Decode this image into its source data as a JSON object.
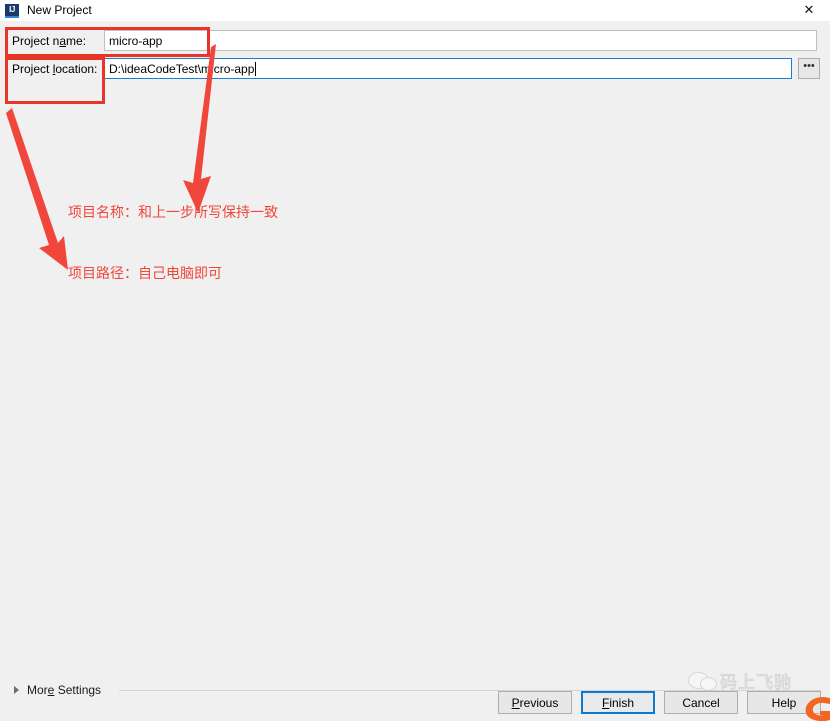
{
  "window": {
    "title": "New Project",
    "icon": "intellij-idea-icon",
    "icon_text": "IJ",
    "close_label": "✕"
  },
  "form": {
    "project_name": {
      "label_prefix": "Project n",
      "label_mnemonic": "a",
      "label_suffix": "me:",
      "value": "micro-app",
      "placeholder": ""
    },
    "project_location": {
      "label_prefix": "Project ",
      "label_mnemonic": "l",
      "label_suffix": "ocation:",
      "value": "D:\\ideaCodeTest\\micro-app",
      "placeholder": ""
    },
    "browse_button": {
      "label": "•••",
      "name": "browse-ellipsis-button"
    }
  },
  "footer": {
    "more_settings": {
      "prefix": "Mor",
      "mnemonic": "e",
      "suffix": " Settings"
    },
    "buttons": [
      {
        "id": "previous",
        "prefix": "",
        "mnemonic": "P",
        "suffix": "revious",
        "default": false
      },
      {
        "id": "finish",
        "prefix": "",
        "mnemonic": "F",
        "suffix": "inish",
        "default": true
      },
      {
        "id": "cancel",
        "prefix": "Cancel",
        "mnemonic": "",
        "suffix": "",
        "default": false
      },
      {
        "id": "help",
        "prefix": "Help",
        "mnemonic": "",
        "suffix": "",
        "default": false
      }
    ]
  },
  "annotations": {
    "color": "#f0463c",
    "box_color": "#e8352b",
    "note_1": "项目名称：和上一步所写保持一致",
    "note_2": "项目路径：自己电脑即可"
  },
  "watermark": {
    "text": "码上飞驰",
    "icon": "wechat-icon"
  }
}
